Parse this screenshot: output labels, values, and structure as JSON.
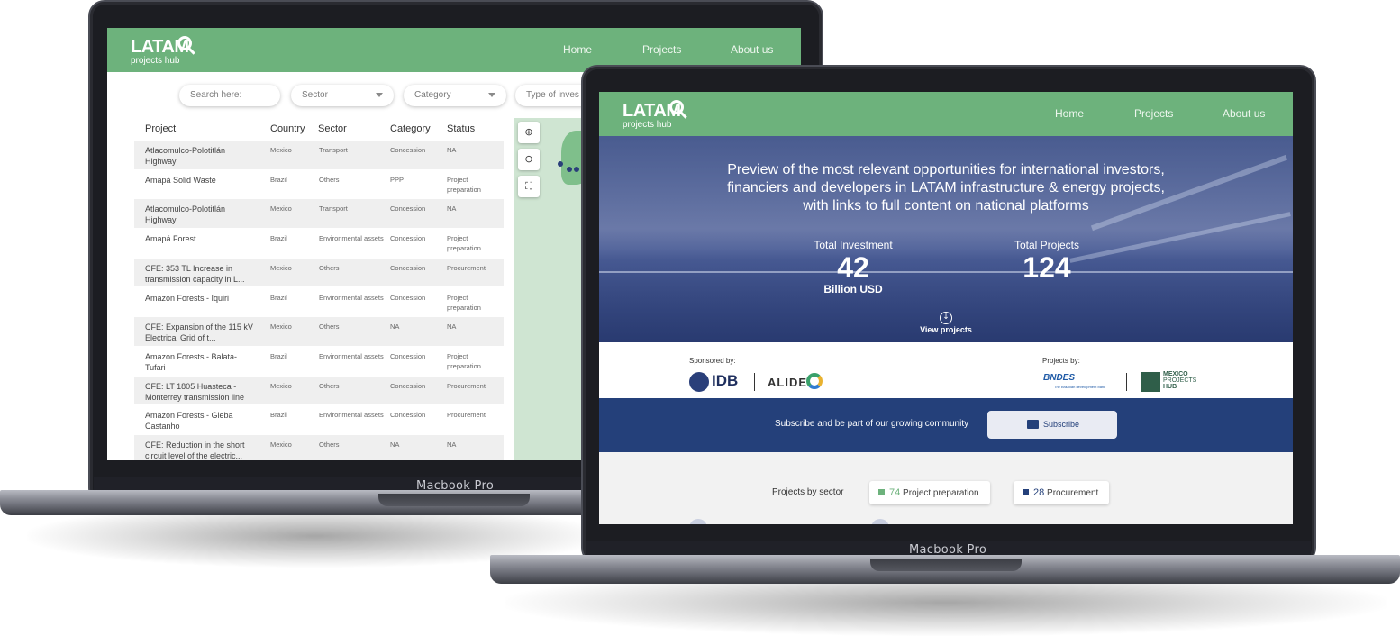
{
  "brand": {
    "line1": "LATAM",
    "line2": "projects hub",
    "green": "#6db27c",
    "navy": "#24407a"
  },
  "nav": {
    "home": "Home",
    "projects": "Projects",
    "about": "About us"
  },
  "device_label": "Macbook Pro",
  "left_screen": {
    "filters": {
      "search_placeholder": "Search here:",
      "sector": "Sector",
      "category": "Category",
      "type": "Type of inves"
    },
    "columns": [
      "Project",
      "Country",
      "Sector",
      "Category",
      "Status"
    ],
    "rows": [
      {
        "project": "Atlacomulco-Polotitlán Highway",
        "country": "Mexico",
        "sector": "Transport",
        "category": "Concession",
        "status": "NA"
      },
      {
        "project": "Amapá Solid Waste",
        "country": "Brazil",
        "sector": "Others",
        "category": "PPP",
        "status": "Project preparation"
      },
      {
        "project": "Atlacomulco-Polotitlán Highway",
        "country": "Mexico",
        "sector": "Transport",
        "category": "Concession",
        "status": "NA"
      },
      {
        "project": "Amapá Forest",
        "country": "Brazil",
        "sector": "Environmental assets",
        "category": "Concession",
        "status": "Project preparation"
      },
      {
        "project": "CFE: 353 TL Increase in transmission capacity in L...",
        "country": "Mexico",
        "sector": "Others",
        "category": "Concession",
        "status": "Procurement"
      },
      {
        "project": "Amazon Forests - Iquiri",
        "country": "Brazil",
        "sector": "Environmental assets",
        "category": "Concession",
        "status": "Project preparation"
      },
      {
        "project": "CFE: Expansion of the 115 kV Electrical Grid of t...",
        "country": "Mexico",
        "sector": "Others",
        "category": "NA",
        "status": "NA"
      },
      {
        "project": "Amazon Forests - Balata-Tufari",
        "country": "Brazil",
        "sector": "Environmental assets",
        "category": "Concession",
        "status": "Project preparation"
      },
      {
        "project": "CFE: LT 1805 Huasteca - Monterrey transmission line",
        "country": "Mexico",
        "sector": "Others",
        "category": "Concession",
        "status": "Procurement"
      },
      {
        "project": "Amazon Forests - Gleba Castanho",
        "country": "Brazil",
        "sector": "Environmental assets",
        "category": "Concession",
        "status": "Procurement"
      },
      {
        "project": "CFE: Reduction in the short circuit level of the electric...",
        "country": "Mexico",
        "sector": "Others",
        "category": "NA",
        "status": "NA"
      }
    ],
    "map_controls": {
      "zoom_in": "⊕",
      "zoom_out": "⊖",
      "fit": "⛶"
    }
  },
  "right_screen": {
    "hero_title": "Preview of the most relevant opportunities for international investors, financiers and developers in LATAM infrastructure & energy projects, with links to full content on national platforms",
    "total_investment_label": "Total Investment",
    "total_investment_value": "42",
    "total_investment_unit": "Billion USD",
    "total_projects_label": "Total Projects",
    "total_projects_value": "124",
    "view_projects": "View projects",
    "sponsored_by": "Sponsored by:",
    "projects_by": "Projects by:",
    "sponsors": [
      "IDB",
      "ALIDE"
    ],
    "partners": {
      "bndes": "BNDES",
      "bndes_sub": "The Brazilian development bank",
      "mexico_l1": "MEXICO",
      "mexico_l2": "PROJECTS",
      "mexico_l3": "HUB"
    },
    "subscribe_text": "Subscribe and be part of our growing community",
    "subscribe_button": "Subscribe",
    "projects_by_sector": "Projects by sector",
    "stats": [
      {
        "count": "74",
        "label": "Project preparation",
        "color": "#6db27c"
      },
      {
        "count": "28",
        "label": "Procurement",
        "color": "#24407a"
      }
    ]
  }
}
